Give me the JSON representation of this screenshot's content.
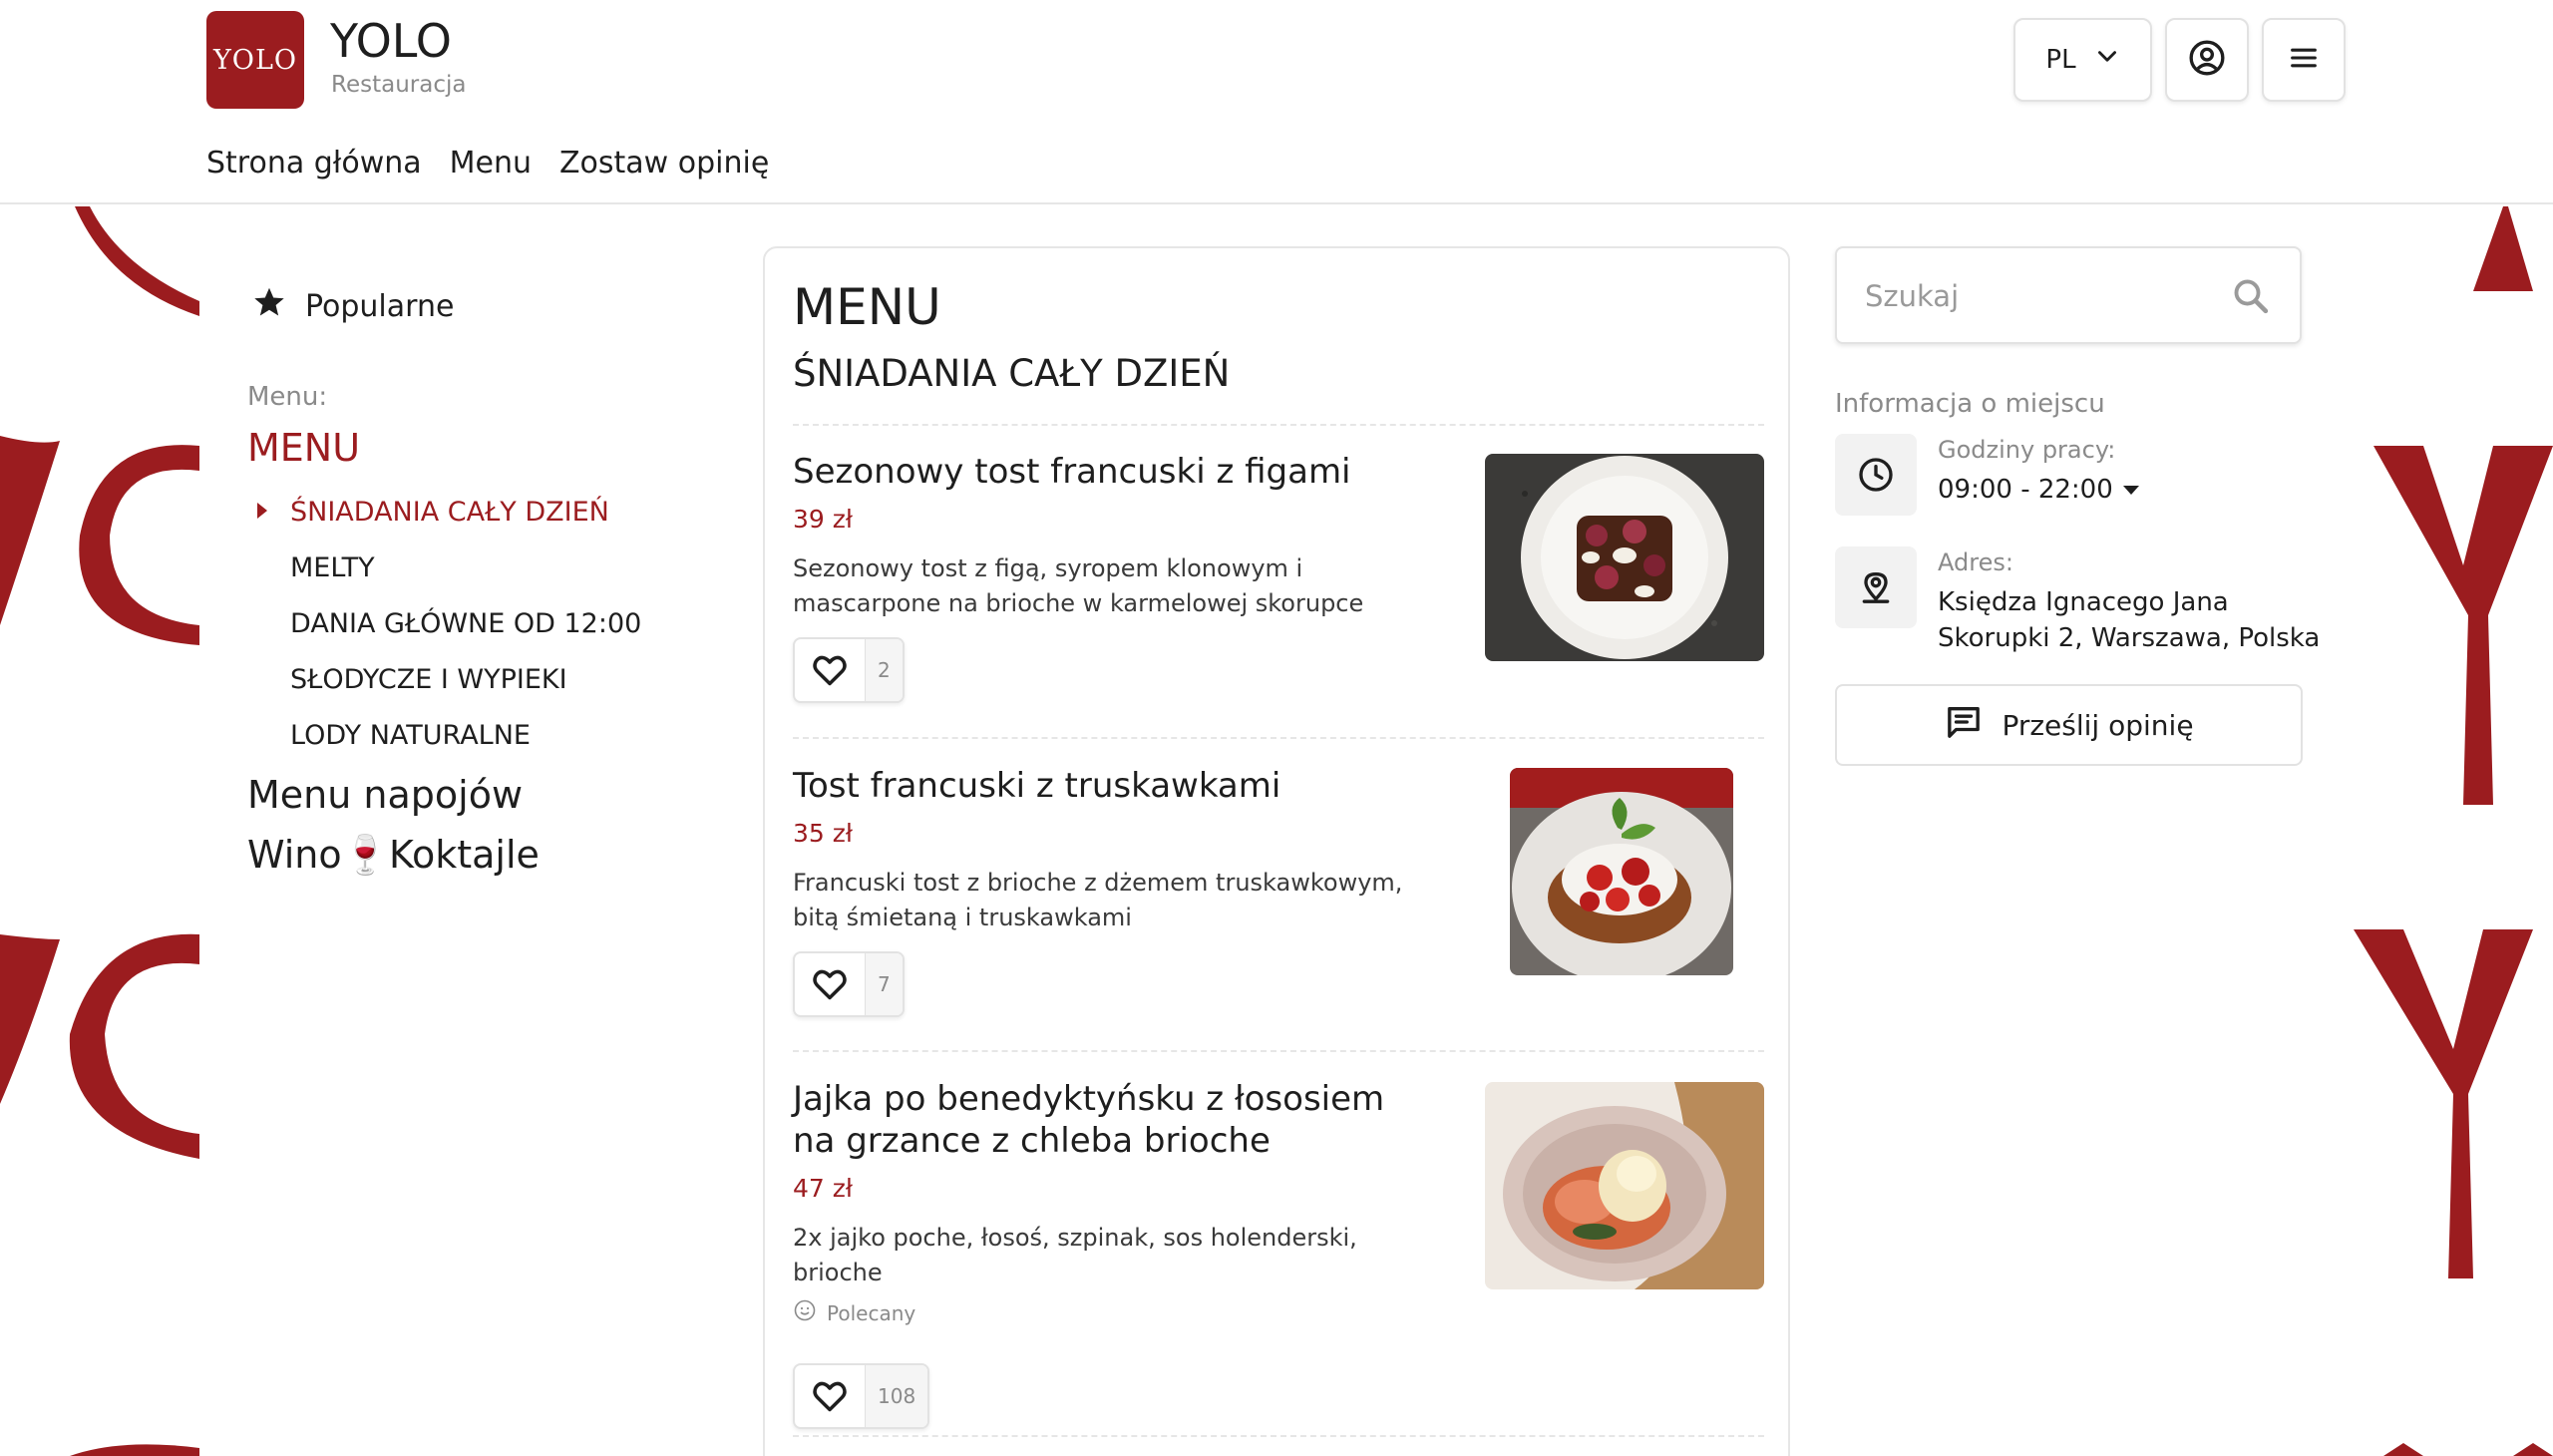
{
  "brand": {
    "logo_text": "YOLO",
    "name": "YOLO",
    "subtitle": "Restauracja",
    "accent_color": "#9b1c1f"
  },
  "nav": {
    "items": [
      {
        "label": "Strona główna"
      },
      {
        "label": "Menu"
      },
      {
        "label": "Zostaw opinię"
      }
    ]
  },
  "header": {
    "language": "PL",
    "icons": [
      "chevron-down-icon",
      "user-circle-icon",
      "hamburger-menu-icon"
    ]
  },
  "sidebar": {
    "popular_label": "Popularne",
    "menu_caption": "Menu:",
    "menu_root": "MENU",
    "subcategories": [
      {
        "label": "ŚNIADANIA CAŁY DZIEŃ",
        "active": true
      },
      {
        "label": "MELTY",
        "active": false
      },
      {
        "label": "DANIA GŁÓWNE OD 12:00",
        "active": false
      },
      {
        "label": "SŁODYCZE I WYPIEKI",
        "active": false
      },
      {
        "label": "LODY NATURALNE",
        "active": false
      }
    ],
    "other_menus": [
      {
        "label": "Menu napojów"
      },
      {
        "label": "Wino🍷Koktajle"
      }
    ]
  },
  "main": {
    "title": "MENU",
    "section_title": "ŚNIADANIA CAŁY DZIEŃ",
    "items": [
      {
        "name": "Sezonowy tost francuski z figami",
        "price": "39 zł",
        "description": "Sezonowy tost z figą, syropem klonowym i mascarpone na brioche w karmelowej skorupce",
        "likes": "2"
      },
      {
        "name": "Tost francuski z truskawkami",
        "price": "35 zł",
        "description": "Francuski tost z brioche z dżemem truskawkowym, bitą śmietaną i truskawkami",
        "likes": "7"
      },
      {
        "name": "Jajka po benedyktyńsku z łososiem na grzance z chleba brioche",
        "price": "47 zł",
        "description": "2x jajko poche, łosoś, szpinak, sos holenderski, brioche",
        "badge": "Polecany",
        "likes": "108"
      }
    ]
  },
  "right": {
    "search_placeholder": "Szukaj",
    "info_title": "Informacja o miejscu",
    "hours_label": "Godziny pracy:",
    "hours_value": "09:00 - 22:00",
    "address_label": "Adres:",
    "address_line1": "Księdza Ignacego Jana",
    "address_line2": "Skorupki 2, Warszawa, Polska",
    "feedback_label": "Prześlij opinię"
  }
}
